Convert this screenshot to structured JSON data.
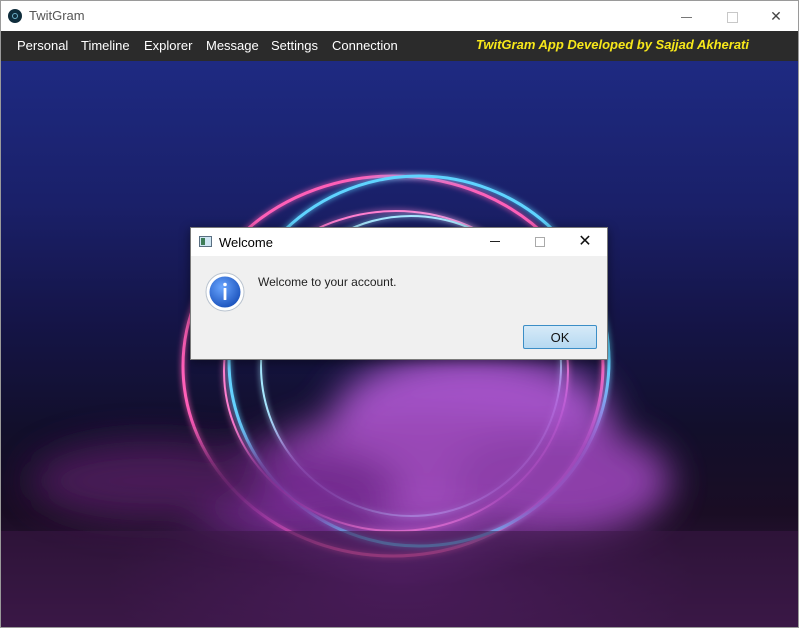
{
  "window": {
    "title": "TwitGram",
    "controls": {
      "minimize": "minimize-icon",
      "maximize": "maximize-icon",
      "close": "close-icon"
    }
  },
  "menubar": {
    "items": [
      "Personal",
      "Timeline",
      "Explorer",
      "Message",
      "Settings",
      "Connection"
    ],
    "credit": "TwitGram App Developed by Sajjad Akherati",
    "credit_color": "#f7e81a",
    "background": "#2b2b2b"
  },
  "dialog": {
    "title": "Welcome",
    "message": "Welcome to your account.",
    "ok_label": "OK",
    "icon": "info-icon",
    "close_glyph": "✕"
  },
  "colors": {
    "accent": "#3c8ec6",
    "info_blue": "#2f6fd1"
  }
}
